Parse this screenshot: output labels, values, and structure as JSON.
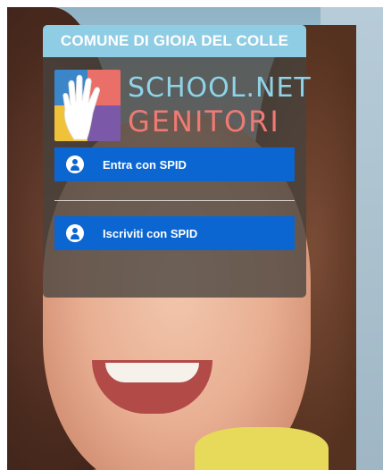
{
  "header": {
    "title": "COMUNE DI GIOIA DEL COLLE"
  },
  "logo": {
    "line1": "SCHOOL.NET",
    "line2": "GENITORI",
    "colors": [
      "#3a86c8",
      "#ea6f68",
      "#f0c23a",
      "#7b59a8"
    ]
  },
  "actions": {
    "login_label": "Entra con SPID",
    "register_label": "Iscriviti con SPID"
  },
  "icons": {
    "user": "user-circle-icon",
    "hand": "hand-icon"
  },
  "colors": {
    "header_bg": "#8fcde4",
    "button_bg": "#0b66d1",
    "panel_bg": "rgba(70,66,62,0.78)",
    "brand_blue": "#8fd3e9",
    "brand_red": "#ef7a74"
  }
}
